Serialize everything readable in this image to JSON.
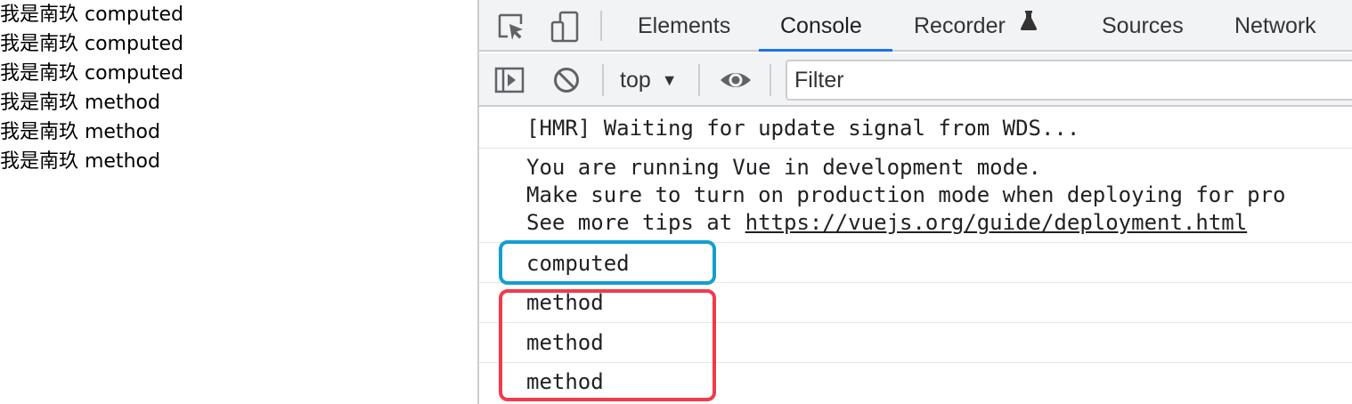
{
  "page": {
    "lines": [
      "我是南玖 computed",
      "我是南玖 computed",
      "我是南玖 computed",
      "我是南玖 method",
      "我是南玖 method",
      "我是南玖 method"
    ]
  },
  "devtools": {
    "toolbar": {
      "inspect_icon": "inspect-element-icon",
      "device_icon": "device-toolbar-icon"
    },
    "tabs": [
      {
        "label": "Elements",
        "active": false
      },
      {
        "label": "Console",
        "active": true
      },
      {
        "label": "Recorder",
        "active": false,
        "icon": "flask-icon"
      },
      {
        "label": "Sources",
        "active": false
      },
      {
        "label": "Network",
        "active": false
      }
    ],
    "console_toolbar": {
      "sidebar_icon": "show-sidebar-icon",
      "clear_icon": "clear-console-icon",
      "context": "top",
      "eye_icon": "live-expression-eye-icon",
      "filter_placeholder": "Filter"
    },
    "messages": [
      {
        "lines": [
          {
            "text": "[HMR] Waiting for update signal from WDS..."
          }
        ]
      },
      {
        "lines": [
          {
            "text": "You are running Vue in development mode."
          },
          {
            "text": "Make sure to turn on production mode when deploying for pro"
          },
          {
            "prefix": "See more tips at ",
            "link": "https://vuejs.org/guide/deployment.html"
          }
        ]
      },
      {
        "lines": [
          {
            "text": "computed"
          }
        ]
      },
      {
        "lines": [
          {
            "text": "method"
          }
        ]
      },
      {
        "lines": [
          {
            "text": "method"
          }
        ]
      },
      {
        "lines": [
          {
            "text": "method"
          }
        ]
      }
    ],
    "highlights": {
      "computed_color": "#139fd0",
      "method_color": "#f23a4a"
    }
  },
  "colors": {
    "toolbar_bg": "#f1f3f4",
    "border": "#cbcdd1",
    "active_tab_underline": "#1a73e8",
    "text": "#202124"
  }
}
